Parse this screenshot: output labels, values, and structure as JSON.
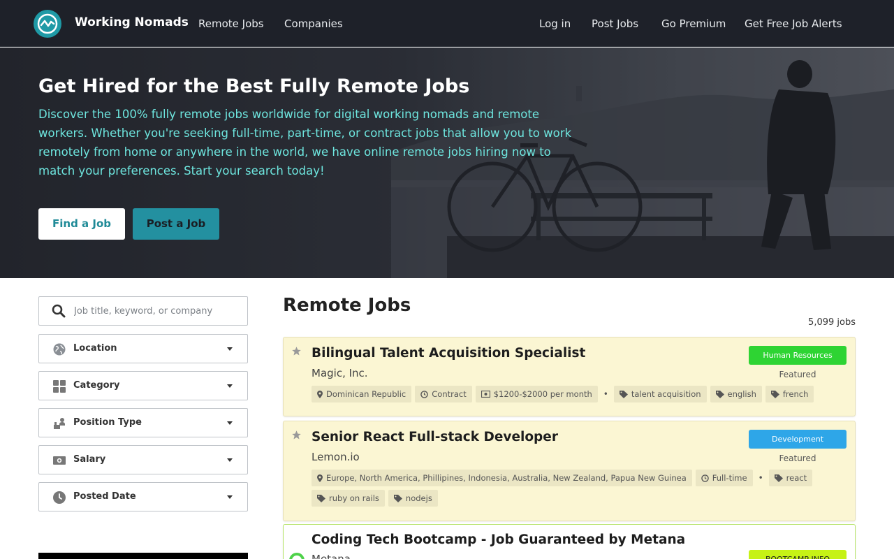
{
  "nav": {
    "brand": "Working Nomads",
    "left_links": [
      "Remote Jobs",
      "Companies"
    ],
    "right_links": [
      "Log in",
      "Post Jobs",
      "Go Premium",
      "Get Free Job Alerts"
    ]
  },
  "hero": {
    "title": "Get Hired for the Best Fully Remote Jobs",
    "description": "Discover the 100% fully remote jobs worldwide for digital working nomads and remote workers. Whether you're seeking full-time, part-time, or contract jobs that allow you to work remotely from home or anywhere in the world, we have online remote jobs hiring now to match your preferences. Start your search today!",
    "find_button": "Find a Job",
    "post_button": "Post a Job"
  },
  "sidebar": {
    "search_placeholder": "Job title, keyword, or company",
    "filters": [
      {
        "label": "Location",
        "icon": "globe-icon"
      },
      {
        "label": "Category",
        "icon": "grid-icon"
      },
      {
        "label": "Position Type",
        "icon": "position-type-icon"
      },
      {
        "label": "Salary",
        "icon": "money-icon"
      },
      {
        "label": "Posted Date",
        "icon": "clock-icon"
      }
    ]
  },
  "main": {
    "title": "Remote Jobs",
    "count": "5,099 jobs"
  },
  "jobs": [
    {
      "title": "Bilingual Talent Acquisition Specialist",
      "company": "Magic, Inc.",
      "category": "Human Resources",
      "category_color": "#2ed433",
      "featured": "Featured",
      "location": "Dominican Republic",
      "type": "Contract",
      "salary": "$1200-$2000 per month",
      "tags": [
        "talent acquisition",
        "english",
        "french"
      ]
    },
    {
      "title": "Senior React Full-stack Developer",
      "company": "Lemon.io",
      "category": "Development",
      "category_color": "#2ea6e8",
      "featured": "Featured",
      "location": "Europe, North America, Phillipines, Indonesia, Australia, New Zealand, Papua New Guinea",
      "type": "Full-time",
      "tags": [
        "react",
        "ruby on rails",
        "nodejs"
      ]
    },
    {
      "title": "Coding Tech Bootcamp - Job Guaranteed by Metana",
      "company": "Metana",
      "badge": "BOOTCAMP INFO",
      "badge_color": "#c6f216"
    }
  ],
  "colors": {
    "nav_bg": "#1e2129",
    "accent": "#2390a0",
    "hero_text": "#6ee6df",
    "featured_bg": "#fbf6d3"
  }
}
